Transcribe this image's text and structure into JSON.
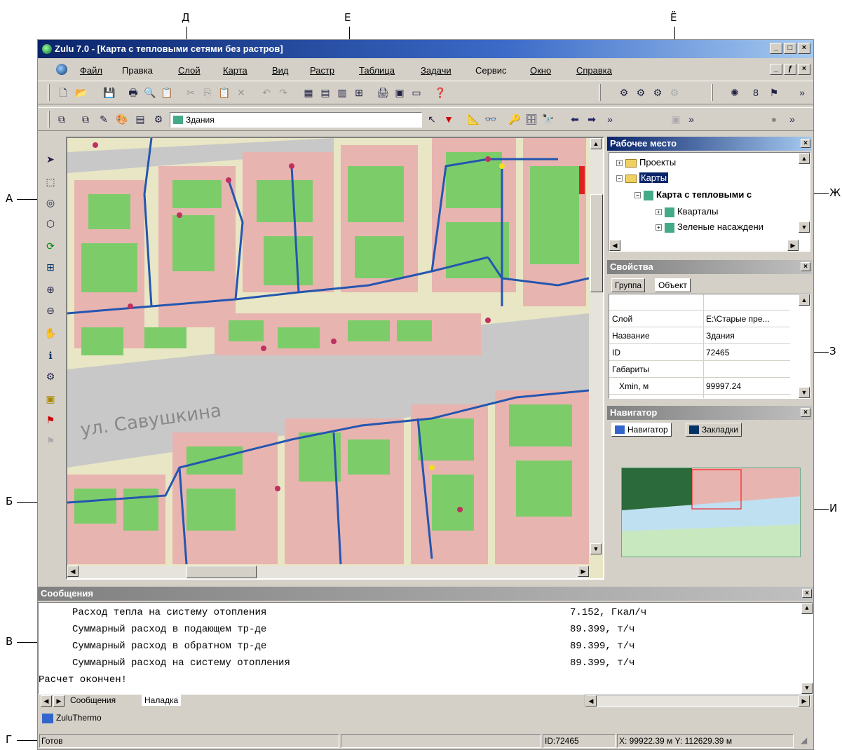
{
  "callouts": {
    "a": "А",
    "b": "Б",
    "v": "В",
    "g": "Г",
    "d": "Д",
    "e": "Е",
    "yo": "Ё",
    "zh": "Ж",
    "z": "З",
    "i": "И"
  },
  "window": {
    "title": "Zulu 7.0 - [Карта с тепловыми сетями без растров]",
    "buttons": [
      "_",
      "□",
      "×"
    ],
    "child_buttons": [
      "_",
      "ƒ",
      "×"
    ]
  },
  "menu": [
    "Файл",
    "Правка",
    "Слой",
    "Карта",
    "Вид",
    "Растр",
    "Таблица",
    "Задачи",
    "Сервис",
    "Окно",
    "Справка"
  ],
  "toolbar2": {
    "layer_combo": "Здания"
  },
  "map": {
    "street_label": "ул. Савушкина",
    "colors": {
      "bg": "#e8e6c4",
      "block": "#e8b4b0",
      "green": "#7ccd6a",
      "road": "#c8c8c8",
      "pipe": "#2456b0"
    }
  },
  "workspace": {
    "title": "Рабочее место",
    "items": [
      "Проекты",
      "Карты",
      "Карта с тепловыми с",
      "Кварталы",
      "Зеленые насаждени"
    ]
  },
  "properties": {
    "title": "Свойства",
    "tabs": [
      "Группа",
      "Объект"
    ],
    "rows": [
      {
        "name": "Слой",
        "value": "E:\\Старые пре..."
      },
      {
        "name": "Название",
        "value": "Здания"
      },
      {
        "name": "ID",
        "value": "72465"
      },
      {
        "name": "Габариты",
        "value": ""
      },
      {
        "name": "Xmin, м",
        "value": "99997.24"
      }
    ]
  },
  "navigator": {
    "title": "Навигатор",
    "tabs": [
      "Навигатор",
      "Закладки"
    ]
  },
  "messages": {
    "title": "Сообщения",
    "lines": [
      {
        "label": "Расход тепла на систему отопления",
        "value": "7.152, Гкал/ч"
      },
      {
        "label": "Суммарный расход в подающем тр-де",
        "value": "89.399, т/ч"
      },
      {
        "label": "Суммарный расход в обратном тр-де",
        "value": "89.399, т/ч"
      },
      {
        "label": "Суммарный расход на систему отопления",
        "value": "89.399, т/ч"
      }
    ],
    "final": "Расчет окончен!",
    "tabs": [
      "Сообщения",
      "Наладка"
    ]
  },
  "taskbar": {
    "item": "ZuluThermo"
  },
  "status": {
    "ready": "Готов",
    "id": "ID:72465",
    "coords": "X: 99922.39 м Y: 112629.39 м"
  }
}
